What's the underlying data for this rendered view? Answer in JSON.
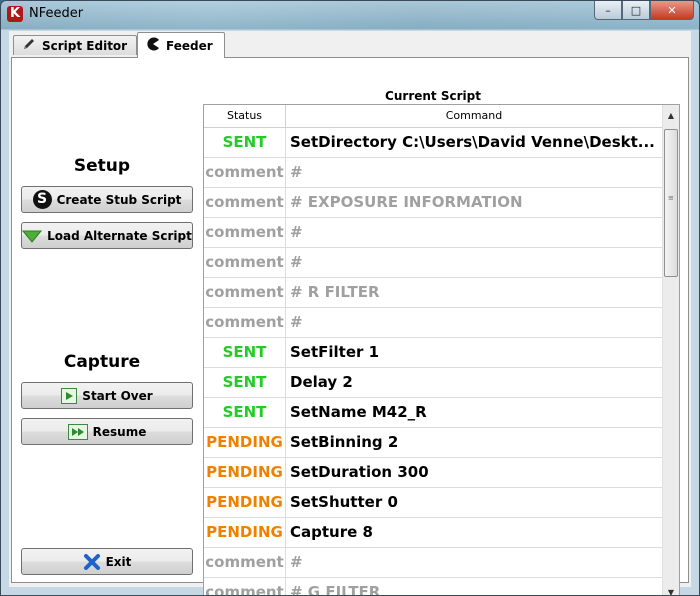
{
  "window": {
    "title": "NFeeder",
    "app_icon_letter": "K"
  },
  "window_controls": {
    "minimize": "–",
    "maximize": "□",
    "close": "✕"
  },
  "tabs": [
    {
      "label": "Script Editor",
      "icon": "pencil-icon",
      "active": false
    },
    {
      "label": "Feeder",
      "icon": "pacman-icon",
      "active": true
    }
  ],
  "setup": {
    "heading": "Setup",
    "create_stub_label": "Create Stub Script",
    "load_alternate_label": "Load Alternate Script"
  },
  "capture": {
    "heading": "Capture",
    "start_over_label": "Start Over",
    "resume_label": "Resume",
    "exit_label": "Exit"
  },
  "script": {
    "caption": "Current Script",
    "headers": {
      "status": "Status",
      "command": "Command"
    },
    "status_colors": {
      "SENT": "#22cc22",
      "PENDING": "#f08000",
      "comment": "#a0a0a0"
    },
    "rows": [
      {
        "status": "SENT",
        "command": "SetDirectory C:\\Users\\David Venne\\Deskt..."
      },
      {
        "status": "comment",
        "command": "#"
      },
      {
        "status": "comment",
        "command": "# EXPOSURE INFORMATION"
      },
      {
        "status": "comment",
        "command": "#"
      },
      {
        "status": "comment",
        "command": "#"
      },
      {
        "status": "comment",
        "command": "# R FILTER"
      },
      {
        "status": "comment",
        "command": "#"
      },
      {
        "status": "SENT",
        "command": "SetFilter 1"
      },
      {
        "status": "SENT",
        "command": "Delay 2"
      },
      {
        "status": "SENT",
        "command": "SetName M42_R"
      },
      {
        "status": "PENDING",
        "command": "SetBinning 2"
      },
      {
        "status": "PENDING",
        "command": "SetDuration 300"
      },
      {
        "status": "PENDING",
        "command": "SetShutter 0"
      },
      {
        "status": "PENDING",
        "command": "Capture 8"
      },
      {
        "status": "comment",
        "command": "#"
      },
      {
        "status": "comment",
        "command": "# G FILTER"
      }
    ]
  }
}
